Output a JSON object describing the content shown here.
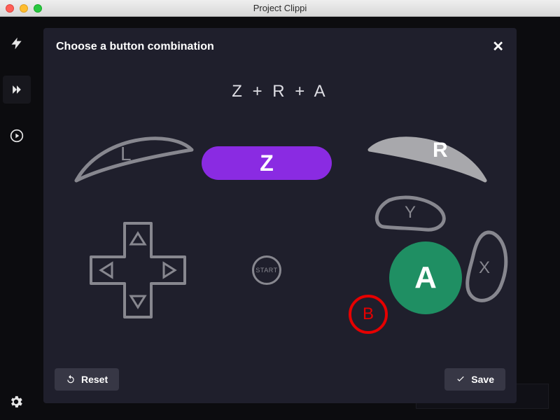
{
  "window": {
    "title": "Project Clippi"
  },
  "modal": {
    "title": "Choose a button combination",
    "combo_text": "Z + R + A",
    "buttons": {
      "L": {
        "label": "L",
        "selected": false
      },
      "R": {
        "label": "R",
        "selected": true
      },
      "Z": {
        "label": "Z",
        "selected": true
      },
      "Y": {
        "label": "Y",
        "selected": false
      },
      "A": {
        "label": "A",
        "selected": true
      },
      "X": {
        "label": "X",
        "selected": false
      },
      "B": {
        "label": "B",
        "selected": false
      },
      "start": {
        "label": "START"
      },
      "dpad_up": {
        "label": "▲"
      },
      "dpad_down": {
        "label": "▼"
      },
      "dpad_left": {
        "label": "◀"
      },
      "dpad_right": {
        "label": "▶"
      }
    },
    "footer": {
      "reset_label": "Reset",
      "save_label": "Save"
    }
  },
  "colors": {
    "accent_purple": "#8a2be2",
    "a_green": "#1f8f63",
    "b_red": "#e60000",
    "shape_outline": "#87878f",
    "shape_fill_selected": "#a8a8ac"
  }
}
